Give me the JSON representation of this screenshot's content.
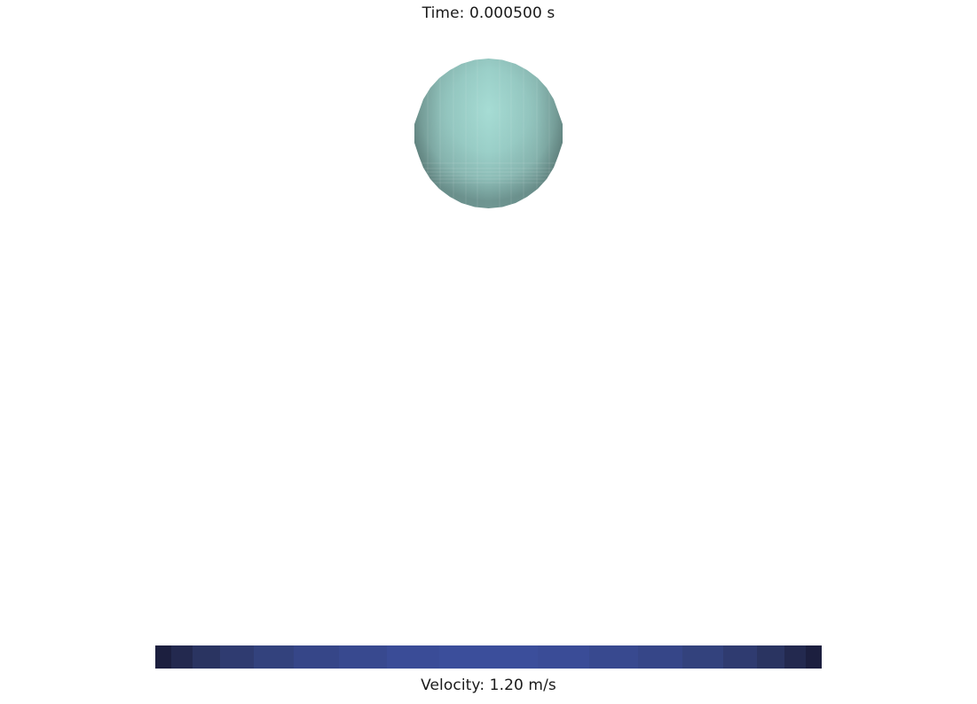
{
  "overlay": {
    "time_label": "Time: 0.000500 s",
    "velocity_label": "Velocity: 1.20 m/s"
  },
  "scene": {
    "object": "sphere",
    "object_color": "#9fd4cd",
    "background_color": "#ffffff"
  },
  "colorbar": {
    "colors": [
      "#1c1f3f",
      "#23294f",
      "#2a3461",
      "#2f3b70",
      "#33427d",
      "#364688",
      "#38498f",
      "#3a4c97",
      "#3b4e9b",
      "#3a4c97",
      "#38498f",
      "#364688",
      "#33427d",
      "#2f3b70",
      "#2a3461",
      "#23294f",
      "#1c1f3f"
    ]
  }
}
